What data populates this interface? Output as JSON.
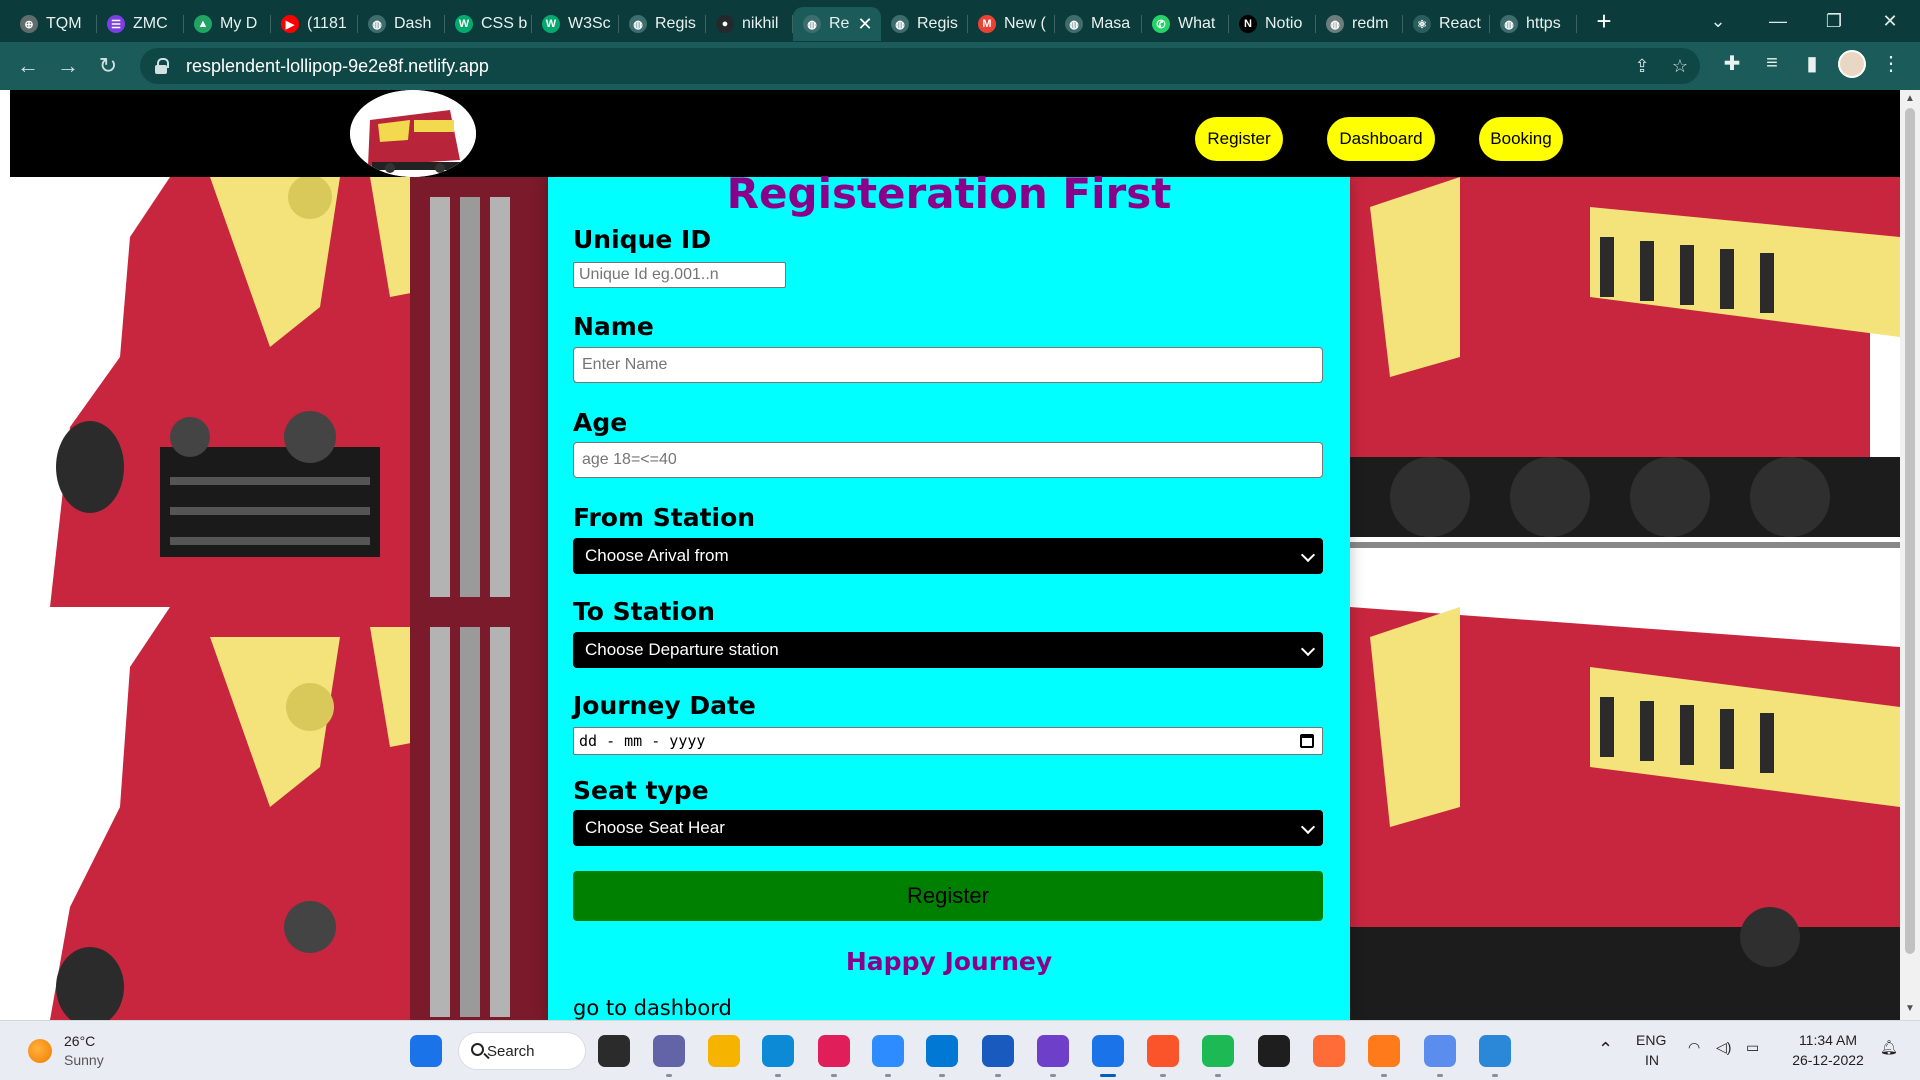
{
  "browser": {
    "tabs": [
      {
        "label": "TQM",
        "icon": "chatgpt-icon",
        "color": "#5f6d6c",
        "glyph": "⊕"
      },
      {
        "label": "ZMC",
        "icon": "list-icon",
        "color": "#7b3fe4",
        "glyph": "☰"
      },
      {
        "label": "My D",
        "icon": "drive-icon",
        "color": "#1fa463",
        "glyph": "▲"
      },
      {
        "label": "(1181",
        "icon": "youtube-icon",
        "color": "#ff0000",
        "glyph": "▶"
      },
      {
        "label": "Dash",
        "icon": "globe-icon",
        "color": "#3d6d6c",
        "glyph": "◍"
      },
      {
        "label": "CSS b",
        "icon": "w3schools-icon",
        "color": "#04aa6d",
        "glyph": "W"
      },
      {
        "label": "W3Sc",
        "icon": "w3schools-icon",
        "color": "#04aa6d",
        "glyph": "W"
      },
      {
        "label": "Regis",
        "icon": "globe-icon",
        "color": "#3d6d6c",
        "glyph": "◍"
      },
      {
        "label": "nikhil",
        "icon": "github-icon",
        "color": "#24292e",
        "glyph": "●"
      },
      {
        "label": "Re",
        "icon": "globe-icon",
        "color": "#3d6d6c",
        "glyph": "◍",
        "active": true
      },
      {
        "label": "Regis",
        "icon": "globe-icon",
        "color": "#3d6d6c",
        "glyph": "◍"
      },
      {
        "label": "New (",
        "icon": "gmail-icon",
        "color": "#ea4335",
        "glyph": "M"
      },
      {
        "label": "Masa",
        "icon": "globe-icon",
        "color": "#3d6d6c",
        "glyph": "◍"
      },
      {
        "label": "What",
        "icon": "whatsapp-icon",
        "color": "#25d366",
        "glyph": "✆"
      },
      {
        "label": "Notio",
        "icon": "notion-icon",
        "color": "#000000",
        "glyph": "N"
      },
      {
        "label": "redm",
        "icon": "globe-icon",
        "color": "#6b7d7c",
        "glyph": "◍"
      },
      {
        "label": "React",
        "icon": "react-icon",
        "color": "#2b5d5c",
        "glyph": "⚛"
      },
      {
        "label": "https",
        "icon": "globe-icon",
        "color": "#3d6d6c",
        "glyph": "◍"
      }
    ],
    "url": "resplendent-lollipop-9e2e8f.netlify.app"
  },
  "site": {
    "nav": {
      "register": "Register",
      "dashboard": "Dashboard",
      "booking": "Booking"
    },
    "form": {
      "title": "Registeration First",
      "unique_id": {
        "label": "Unique ID",
        "placeholder": "Unique Id eg.001..n"
      },
      "name": {
        "label": "Name",
        "placeholder": "Enter Name"
      },
      "age": {
        "label": "Age",
        "placeholder": "age 18=<=40"
      },
      "from_station": {
        "label": "From Station",
        "selected": "Choose Arival from"
      },
      "to_station": {
        "label": "To Station",
        "selected": "Choose Departure station"
      },
      "journey_date": {
        "label": "Journey Date",
        "value": "dd - mm - yyyy"
      },
      "seat_type": {
        "label": "Seat type",
        "selected": "Choose Seat Hear"
      },
      "submit": "Register",
      "tagline": "Happy Journey",
      "dashboard_link": "go to dashbord"
    },
    "colors": {
      "panel": "#00ffff",
      "title": "#8b008b",
      "nav_pill": "#ffff00",
      "submit": "#008000",
      "header": "#000000"
    }
  },
  "taskbar": {
    "weather": {
      "temp": "26°C",
      "condition": "Sunny"
    },
    "search_label": "Search",
    "apps": [
      {
        "name": "windows-start-icon",
        "color": "#1a73e8"
      },
      {
        "name": "task-view-icon",
        "color": "#2b2b2b"
      },
      {
        "name": "teams-chat-icon",
        "color": "#6264a7"
      },
      {
        "name": "file-explorer-icon",
        "color": "#f6b400"
      },
      {
        "name": "edge-icon",
        "color": "#0c8ad6"
      },
      {
        "name": "slack-icon",
        "color": "#e01e5a"
      },
      {
        "name": "zoom-icon",
        "color": "#2d8cff"
      },
      {
        "name": "vscode-icon",
        "color": "#0078d4"
      },
      {
        "name": "word-icon",
        "color": "#185abd"
      },
      {
        "name": "github-desktop-icon",
        "color": "#6e40c9"
      },
      {
        "name": "chrome-icon",
        "color": "#1a73e8"
      },
      {
        "name": "brave-icon",
        "color": "#fb542b"
      },
      {
        "name": "spotify-icon",
        "color": "#1db954"
      },
      {
        "name": "terminal-icon",
        "color": "#1e1e1e"
      },
      {
        "name": "postman-icon",
        "color": "#ff6c37"
      },
      {
        "name": "qbittorrent-icon",
        "color": "#ff7a1a"
      },
      {
        "name": "snipping-tool-icon",
        "color": "#5b8def"
      },
      {
        "name": "paint-icon",
        "color": "#2b88d8"
      }
    ],
    "lang": {
      "line1": "ENG",
      "line2": "IN"
    },
    "time": "11:34 AM",
    "date": "26-12-2022"
  }
}
